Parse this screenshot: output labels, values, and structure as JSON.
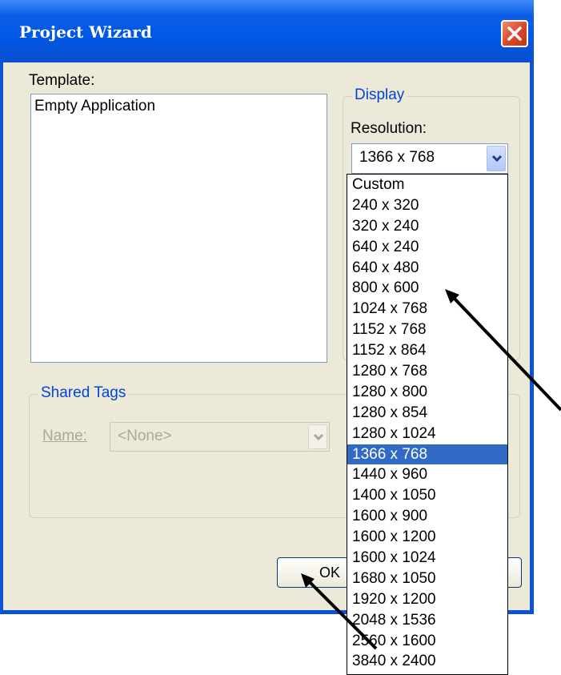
{
  "window": {
    "title": "Project Wizard"
  },
  "template": {
    "label": "Template:",
    "items": [
      "Empty Application"
    ]
  },
  "display": {
    "legend": "Display",
    "resolution_label": "Resolution:",
    "selected": "1366 x 768",
    "options": [
      "Custom",
      "240 x 320",
      "320 x 240",
      "640 x 240",
      "640 x 480",
      "800 x 600",
      "1024 x 768",
      "1152 x 768",
      "1152 x 864",
      "1280 x 768",
      "1280 x 800",
      "1280 x 854",
      "1280 x 1024",
      "1366 x 768",
      "1440 x 960",
      "1400 x 1050",
      "1600 x 900",
      "1600 x 1200",
      "1600 x 1024",
      "1680 x 1050",
      "1920 x 1200",
      "2048 x 1536",
      "2560 x 1600",
      "3840 x 2400"
    ],
    "selected_index": 13
  },
  "shared_tags": {
    "legend": "Shared Tags",
    "name_label": "Name:",
    "name_value": "<None>"
  },
  "buttons": {
    "ok": "OK"
  },
  "colors": {
    "titlebar": "#0058e6",
    "dialog_bg": "#ece9d8",
    "accent": "#0046d5",
    "selection": "#316ac5",
    "arrow": "#000000"
  }
}
